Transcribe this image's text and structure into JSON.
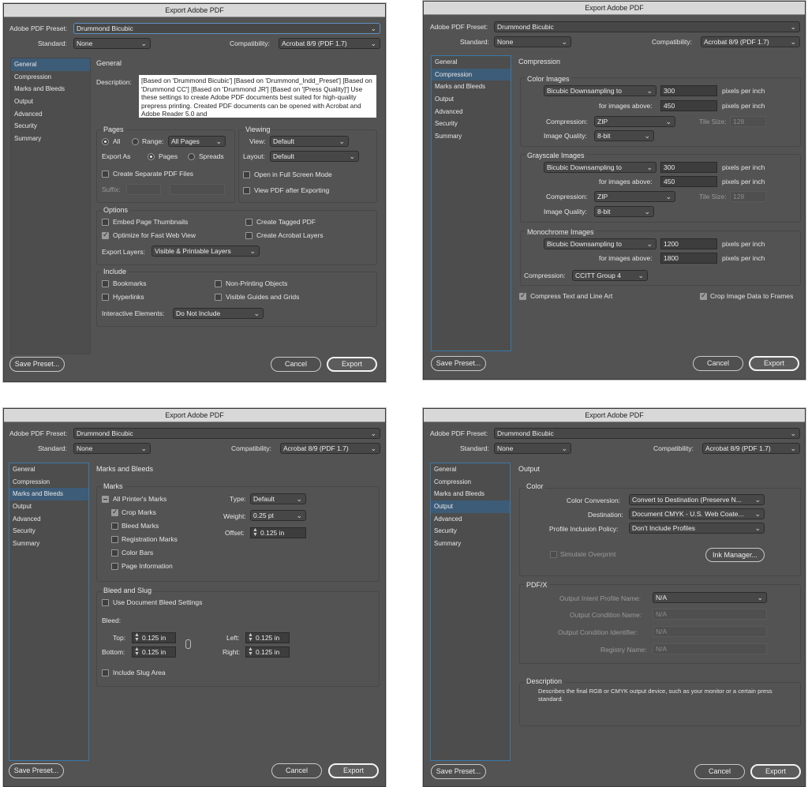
{
  "app": {
    "title": "Export Adobe PDF"
  },
  "common": {
    "preset_label": "Adobe PDF Preset:",
    "preset_value": "Drummond Bicubic",
    "standard_label": "Standard:",
    "standard_value": "None",
    "compat_label": "Compatibility:",
    "compat_value": "Acrobat 8/9 (PDF 1.7)",
    "save_preset": "Save Preset...",
    "cancel": "Cancel",
    "export": "Export",
    "sidebar": [
      "General",
      "Compression",
      "Marks and Bleeds",
      "Output",
      "Advanced",
      "Security",
      "Summary"
    ]
  },
  "general": {
    "heading": "General",
    "description_label": "Description:",
    "description_text": "[Based on 'Drummond Bicubic'] [Based on 'Drummond_Indd_Preset'] [Based on 'Drummond CC'] [Based on 'Drummond JR'] [Based on '[Press Quality]'] Use these settings to create Adobe PDF documents best suited for high-quality prepress printing.  Created PDF documents can be opened with Acrobat and Adobe Reader 5.0 and",
    "pages": {
      "title": "Pages",
      "all": "All",
      "range": "Range:",
      "range_value": "All Pages",
      "export_as": "Export As",
      "pages_opt": "Pages",
      "spreads_opt": "Spreads",
      "separate": "Create Separate PDF Files",
      "suffix": "Suffix:"
    },
    "viewing": {
      "title": "Viewing",
      "view_label": "View:",
      "view_value": "Default",
      "layout_label": "Layout:",
      "layout_value": "Default",
      "fullscreen": "Open in Full Screen Mode",
      "view_after": "View PDF after Exporting"
    },
    "options": {
      "title": "Options",
      "thumbs": "Embed Page Thumbnails",
      "fastweb": "Optimize for Fast Web View",
      "tagged": "Create Tagged PDF",
      "acro_layers": "Create Acrobat Layers",
      "export_layers_label": "Export Layers:",
      "export_layers_value": "Visible & Printable Layers"
    },
    "include": {
      "title": "Include",
      "bookmarks": "Bookmarks",
      "hyperlinks": "Hyperlinks",
      "nonprint": "Non-Printing Objects",
      "guides": "Visible Guides and Grids",
      "interactive_label": "Interactive Elements:",
      "interactive_value": "Do Not Include"
    }
  },
  "compression": {
    "heading": "Compression",
    "color": {
      "title": "Color Images",
      "method": "Bicubic Downsampling to",
      "ppi": "300",
      "ppi_unit": "pixels per inch",
      "above_label": "for images above:",
      "above": "450",
      "above_unit": "pixels per inch",
      "comp_label": "Compression:",
      "comp": "ZIP",
      "tile_label": "Tile Size:",
      "tile": "128",
      "quality_label": "Image Quality:",
      "quality": "8-bit"
    },
    "gray": {
      "title": "Grayscale Images",
      "method": "Bicubic Downsampling to",
      "ppi": "300",
      "ppi_unit": "pixels per inch",
      "above_label": "for images above:",
      "above": "450",
      "above_unit": "pixels per inch",
      "comp_label": "Compression:",
      "comp": "ZIP",
      "tile_label": "Tile Size:",
      "tile": "128",
      "quality_label": "Image Quality:",
      "quality": "8-bit"
    },
    "mono": {
      "title": "Monochrome Images",
      "method": "Bicubic Downsampling to",
      "ppi": "1200",
      "ppi_unit": "pixels per inch",
      "above_label": "for images above:",
      "above": "1800",
      "above_unit": "pixels per inch",
      "comp_label": "Compression:",
      "comp": "CCITT Group 4"
    },
    "compress_text": "Compress Text and Line Art",
    "crop_data": "Crop Image Data to Frames"
  },
  "marks": {
    "heading": "Marks and Bleeds",
    "marks_title": "Marks",
    "all_printers": "All Printer's Marks",
    "crop": "Crop Marks",
    "bleed_marks": "Bleed Marks",
    "registration": "Registration Marks",
    "color_bars": "Color Bars",
    "page_info": "Page Information",
    "type_label": "Type:",
    "type_value": "Default",
    "weight_label": "Weight:",
    "weight_value": "0.25 pt",
    "offset_label": "Offset:",
    "offset_value": "0.125 in",
    "bleed_title": "Bleed and Slug",
    "use_doc_bleed": "Use Document Bleed Settings",
    "bleed_label": "Bleed:",
    "top_label": "Top:",
    "top": "0.125 in",
    "bottom_label": "Bottom:",
    "bottom": "0.125 in",
    "left_label": "Left:",
    "left": "0.125 in",
    "right_label": "Right:",
    "right": "0.125 in",
    "slug": "Include Slug Area"
  },
  "output": {
    "heading": "Output",
    "color_title": "Color",
    "conv_label": "Color Conversion:",
    "conv": "Convert to Destination (Preserve N...",
    "dest_label": "Destination:",
    "dest": "Document CMYK - U.S. Web Coate...",
    "policy_label": "Profile Inclusion Policy:",
    "policy": "Don't Include Profiles",
    "simulate": "Simulate Overprint",
    "ink_manager": "Ink Manager...",
    "pdfx_title": "PDF/X",
    "intent_label": "Output Intent Profile Name:",
    "intent": "N/A",
    "cond_name_label": "Output Condition Name:",
    "cond_name": "N/A",
    "cond_id_label": "Output Condition Identifier:",
    "cond_id": "N/A",
    "registry_label": "Registry Name:",
    "registry": "N/A",
    "desc_title": "Description",
    "desc_text": "Describes the final RGB or CMYK output device, such as your monitor or a certain press standard."
  }
}
